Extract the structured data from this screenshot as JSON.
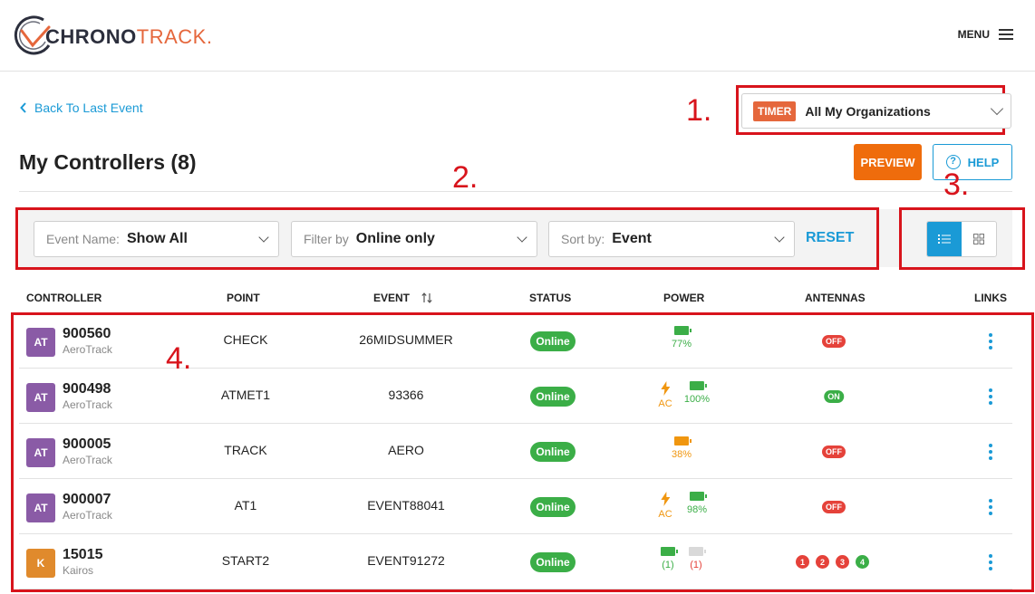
{
  "header": {
    "logo_chrono": "CHRONO",
    "logo_track": "TRACK",
    "logo_registered": ".",
    "menu_label": "MENU"
  },
  "nav": {
    "back_label": "Back To Last Event"
  },
  "org_select": {
    "badge": "TIMER",
    "value": "All My Organizations"
  },
  "page": {
    "title": "My Controllers (8)",
    "preview_label": "PREVIEW",
    "help_label": "HELP",
    "help_glyph": "?"
  },
  "annotations": [
    "1.",
    "2.",
    "3.",
    "4."
  ],
  "filters": {
    "event_label": "Event Name:",
    "event_value": "Show All",
    "filter_label": "Filter by",
    "filter_value": "Online only",
    "sort_label": "Sort by:",
    "sort_value": "Event",
    "reset_label": "RESET",
    "active_view": "list"
  },
  "table": {
    "columns": [
      "CONTROLLER",
      "POINT",
      "EVENT",
      "STATUS",
      "POWER",
      "ANTENNAS",
      "LINKS"
    ],
    "rows": [
      {
        "avatar": "AT",
        "avatar_color": "#8a5ba6",
        "id": "900560",
        "brand": "AeroTrack",
        "point": "CHECK",
        "event": "26MIDSUMMER",
        "status": "Online",
        "ac": "",
        "battery": "77%",
        "battery_color": "#3bae47",
        "antennas": "OFF",
        "antennas_color": "#e5423a"
      },
      {
        "avatar": "AT",
        "avatar_color": "#8a5ba6",
        "id": "900498",
        "brand": "AeroTrack",
        "point": "ATMET1",
        "event": "93366",
        "status": "Online",
        "ac": "AC",
        "battery": "100%",
        "battery_color": "#3bae47",
        "antennas": "ON",
        "antennas_color": "#3bae47"
      },
      {
        "avatar": "AT",
        "avatar_color": "#8a5ba6",
        "id": "900005",
        "brand": "AeroTrack",
        "point": "TRACK",
        "event": "AERO",
        "status": "Online",
        "ac": "",
        "battery": "38%",
        "battery_color": "#f0960f",
        "antennas": "OFF",
        "antennas_color": "#e5423a"
      },
      {
        "avatar": "AT",
        "avatar_color": "#8a5ba6",
        "id": "900007",
        "brand": "AeroTrack",
        "point": "AT1",
        "event": "EVENT88041",
        "status": "Online",
        "ac": "AC",
        "battery": "98%",
        "battery_color": "#3bae47",
        "antennas": "OFF",
        "antennas_color": "#e5423a"
      },
      {
        "avatar": "K",
        "avatar_color": "#e08a2c",
        "id": "15015",
        "brand": "Kairos",
        "point": "START2",
        "event": "EVENT91272",
        "status": "Online",
        "power_a": "(1)",
        "power_b": "(1)",
        "antenna_ports": [
          "1",
          "2",
          "3",
          "4"
        ],
        "antenna_port_colors": [
          "#e5423a",
          "#e5423a",
          "#e5423a",
          "#3bae47"
        ]
      }
    ]
  },
  "colors": {
    "accent_blue": "#1a9ad6",
    "brand_orange": "#e5673c",
    "preview_orange": "#ef6c0c",
    "online_green": "#3bae47",
    "annotation_red": "#d8141c"
  }
}
